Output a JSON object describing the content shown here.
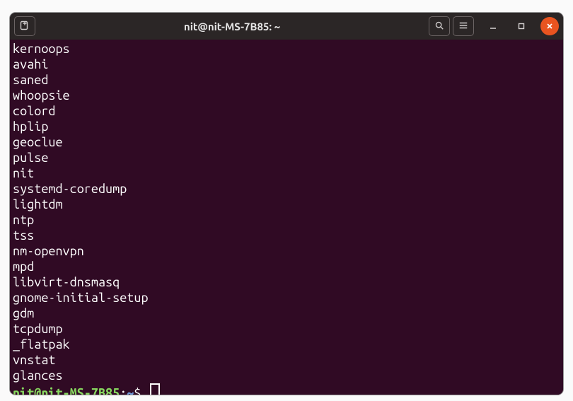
{
  "window": {
    "title": "nit@nit-MS-7B85: ~"
  },
  "titlebar": {
    "icons": {
      "newtab": "new-tab-icon",
      "search": "search-icon",
      "menu": "hamburger-icon",
      "minimize": "minimize-icon",
      "maximize": "maximize-icon",
      "close": "close-icon"
    }
  },
  "terminal": {
    "lines": [
      "kernoops",
      "avahi",
      "saned",
      "whoopsie",
      "colord",
      "hplip",
      "geoclue",
      "pulse",
      "nit",
      "systemd-coredump",
      "lightdm",
      "ntp",
      "tss",
      "nm-openvpn",
      "mpd",
      "libvirt-dnsmasq",
      "gnome-initial-setup",
      "gdm",
      "tcpdump",
      "_flatpak",
      "vnstat",
      "glances"
    ],
    "prompt": {
      "user_host": "nit@nit-MS-7B85",
      "colon": ":",
      "path": "~",
      "symbol": "$"
    }
  }
}
